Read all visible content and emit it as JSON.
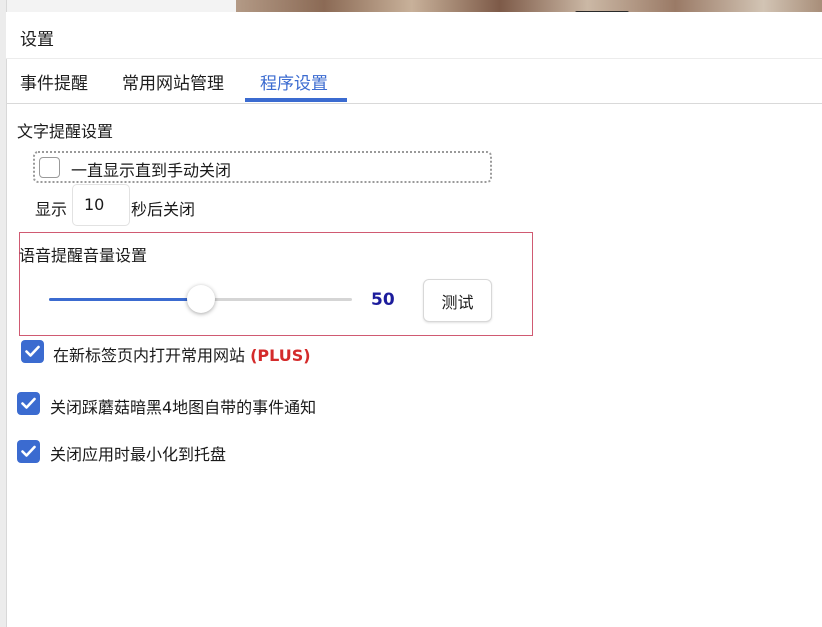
{
  "window": {
    "title": "设置"
  },
  "tabs": [
    {
      "label": "事件提醒",
      "active": false
    },
    {
      "label": "常用网站管理",
      "active": false
    },
    {
      "label": "程序设置",
      "active": true
    }
  ],
  "text_reminder": {
    "section_title": "文字提醒设置",
    "always_show": {
      "label": "一直显示直到手动关闭",
      "checked": false
    },
    "display_prefix": "显示",
    "display_seconds": "10",
    "display_suffix": "秒后关闭"
  },
  "voice_reminder": {
    "section_title": "语音提醒音量设置",
    "volume": 50,
    "volume_label": "50",
    "volume_max": 100,
    "test_button": "测试"
  },
  "options": [
    {
      "label": "在新标签页内打开常用网站",
      "badge": "(PLUS)",
      "checked": true
    },
    {
      "label": "关闭踩蘑菇暗黑4地图自带的事件通知",
      "checked": true
    },
    {
      "label": "关闭应用时最小化到托盘",
      "checked": true
    }
  ],
  "colors": {
    "accent": "#3b6bd0",
    "plus_badge": "#d42b2b",
    "volume_value": "#1c1c9c",
    "focus_border": "#d05a72"
  },
  "icons": {
    "checkbox_checked": "check-icon",
    "window_grip": "drag-handle-icon"
  }
}
